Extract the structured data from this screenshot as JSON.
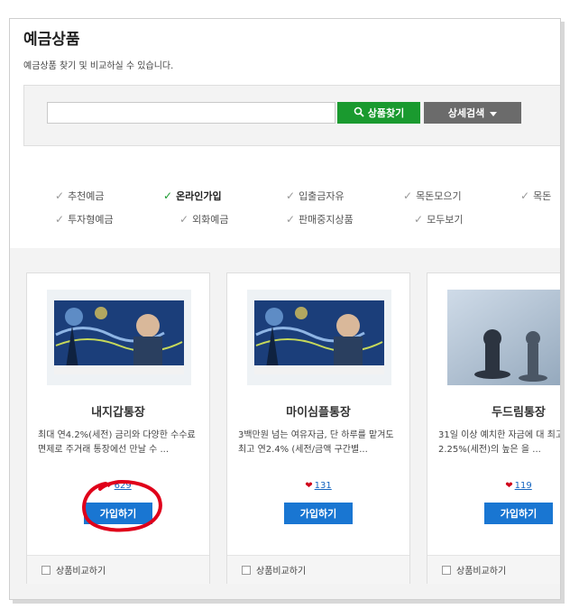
{
  "header": {
    "title": "예금상품",
    "subtitle": "예금상품 찾기 및 비교하실 수 있습니다."
  },
  "search": {
    "value": "",
    "placeholder": "",
    "search_button": "상품찾기",
    "detail_button": "상세검색"
  },
  "filters": {
    "row1": [
      {
        "label": "추천예금",
        "active": false
      },
      {
        "label": "온라인가입",
        "active": true
      },
      {
        "label": "입출금자유",
        "active": false
      },
      {
        "label": "목돈모으기",
        "active": false
      },
      {
        "label": "목돈",
        "active": false
      }
    ],
    "row2": [
      {
        "label": "투자형예금",
        "active": false
      },
      {
        "label": "외화예금",
        "active": false
      },
      {
        "label": "판매중지상품",
        "active": false
      },
      {
        "label": "모두보기",
        "active": false
      }
    ]
  },
  "products": [
    {
      "name": "내지갑통장",
      "desc": "최대 연4.2%(세전) 금리와 다양한 수수료 면제로 주거래 통장에선 만날 수 ...",
      "likes": "629",
      "join_label": "가입하기",
      "compare_label": "상품비교하기",
      "image": "starry-night-promo"
    },
    {
      "name": "마이심플통장",
      "desc": "3백만원 넘는 여유자금, 단 하루를 맡겨도 최고 연2.4% (세전/금액 구간별...",
      "likes": "131",
      "join_label": "가입하기",
      "compare_label": "상품비교하기",
      "image": "starry-night-promo"
    },
    {
      "name": "두드림통장",
      "desc": "31일 이상 예치한 자금에 대 최고 연 2.25%(세전)의 높은 을 ...",
      "likes": "119",
      "join_label": "가입하기",
      "compare_label": "상품비교하기",
      "image": "chess-pieces"
    }
  ],
  "colors": {
    "accent_green": "#1a9a2f",
    "button_blue": "#1976d2",
    "heart_red": "#d0021b",
    "annotation_red": "#e0001a"
  },
  "icons": {
    "search": "magnifier-icon",
    "dropdown": "caret-down-icon",
    "check": "checkmark-icon",
    "heart": "heart-icon"
  }
}
